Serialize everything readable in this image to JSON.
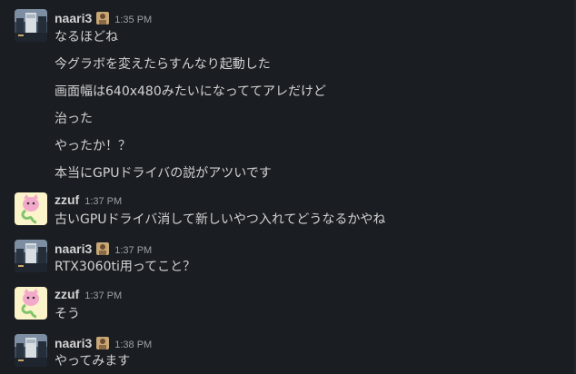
{
  "users": {
    "naari3": {
      "name": "naari3",
      "status_emoji_icon": "status-emoji-icon"
    },
    "zzuf": {
      "name": "zzuf"
    }
  },
  "groups": [
    {
      "user": "naari3",
      "time": "1:35 PM",
      "messages": [
        "なるほどね",
        "今グラボを変えたらすんなり起動した",
        "画面幅は640x480みたいになっててアレだけど",
        "治った",
        "やったか！？",
        "本当にGPUドライバの説がアツいです"
      ]
    },
    {
      "user": "zzuf",
      "time": "1:37 PM",
      "messages": [
        "古いGPUドライバ消して新しいやつ入れてどうなるかやね"
      ]
    },
    {
      "user": "naari3",
      "time": "1:37 PM",
      "messages": [
        "RTX3060ti用ってこと？"
      ]
    },
    {
      "user": "zzuf",
      "time": "1:37 PM",
      "messages": [
        "そう"
      ]
    },
    {
      "user": "naari3",
      "time": "1:38 PM",
      "messages": [
        "やってみます"
      ]
    }
  ],
  "colors": {
    "background": "#1a1d21",
    "text": "#d1d2d3",
    "timestamp": "#9ca0a5"
  }
}
